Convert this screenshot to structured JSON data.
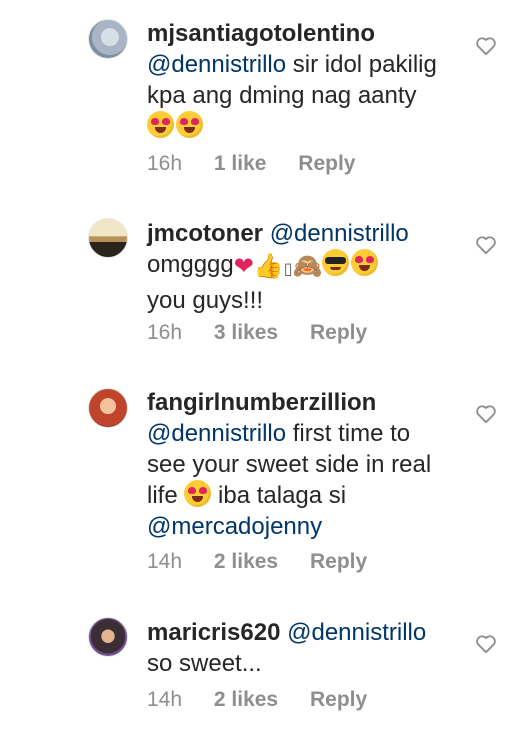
{
  "comments": [
    {
      "username": "mjsantiagotolentino",
      "mention": "@dennistrillo",
      "text": "sir idol pakilig kpa ang dming nag aanty",
      "time": "16h",
      "likes": "1 like",
      "reply": "Reply"
    },
    {
      "username": "jmcotoner",
      "mention": "@dennistrillo",
      "text_before": "omgggg",
      "text_after": "you guys!!!",
      "time": "16h",
      "likes": "3 likes",
      "reply": "Reply"
    },
    {
      "username": "fangirlnumberzillion",
      "mention": "@dennistrillo",
      "text_1": "first time to see your sweet side in real life",
      "text_2": "iba talaga si",
      "mention_2": "@mercadojenny",
      "time": "14h",
      "likes": "2 likes",
      "reply": "Reply"
    },
    {
      "username": "maricris620",
      "mention": "@dennistrillo",
      "text": "so sweet...",
      "time": "14h",
      "likes": "2 likes",
      "reply": "Reply"
    }
  ],
  "icons": {
    "heart_eyes": "heart-eyes-emoji",
    "red_heart": "red-heart-emoji",
    "thumbs_up": "thumbs-up-emoji",
    "see_no_evil": "see-no-evil-monkey-emoji",
    "sunglasses": "sunglasses-emoji",
    "like": "heart-outline-icon"
  },
  "colors": {
    "mention": "#003569",
    "meta": "#8e8e8e",
    "text": "#262626"
  }
}
